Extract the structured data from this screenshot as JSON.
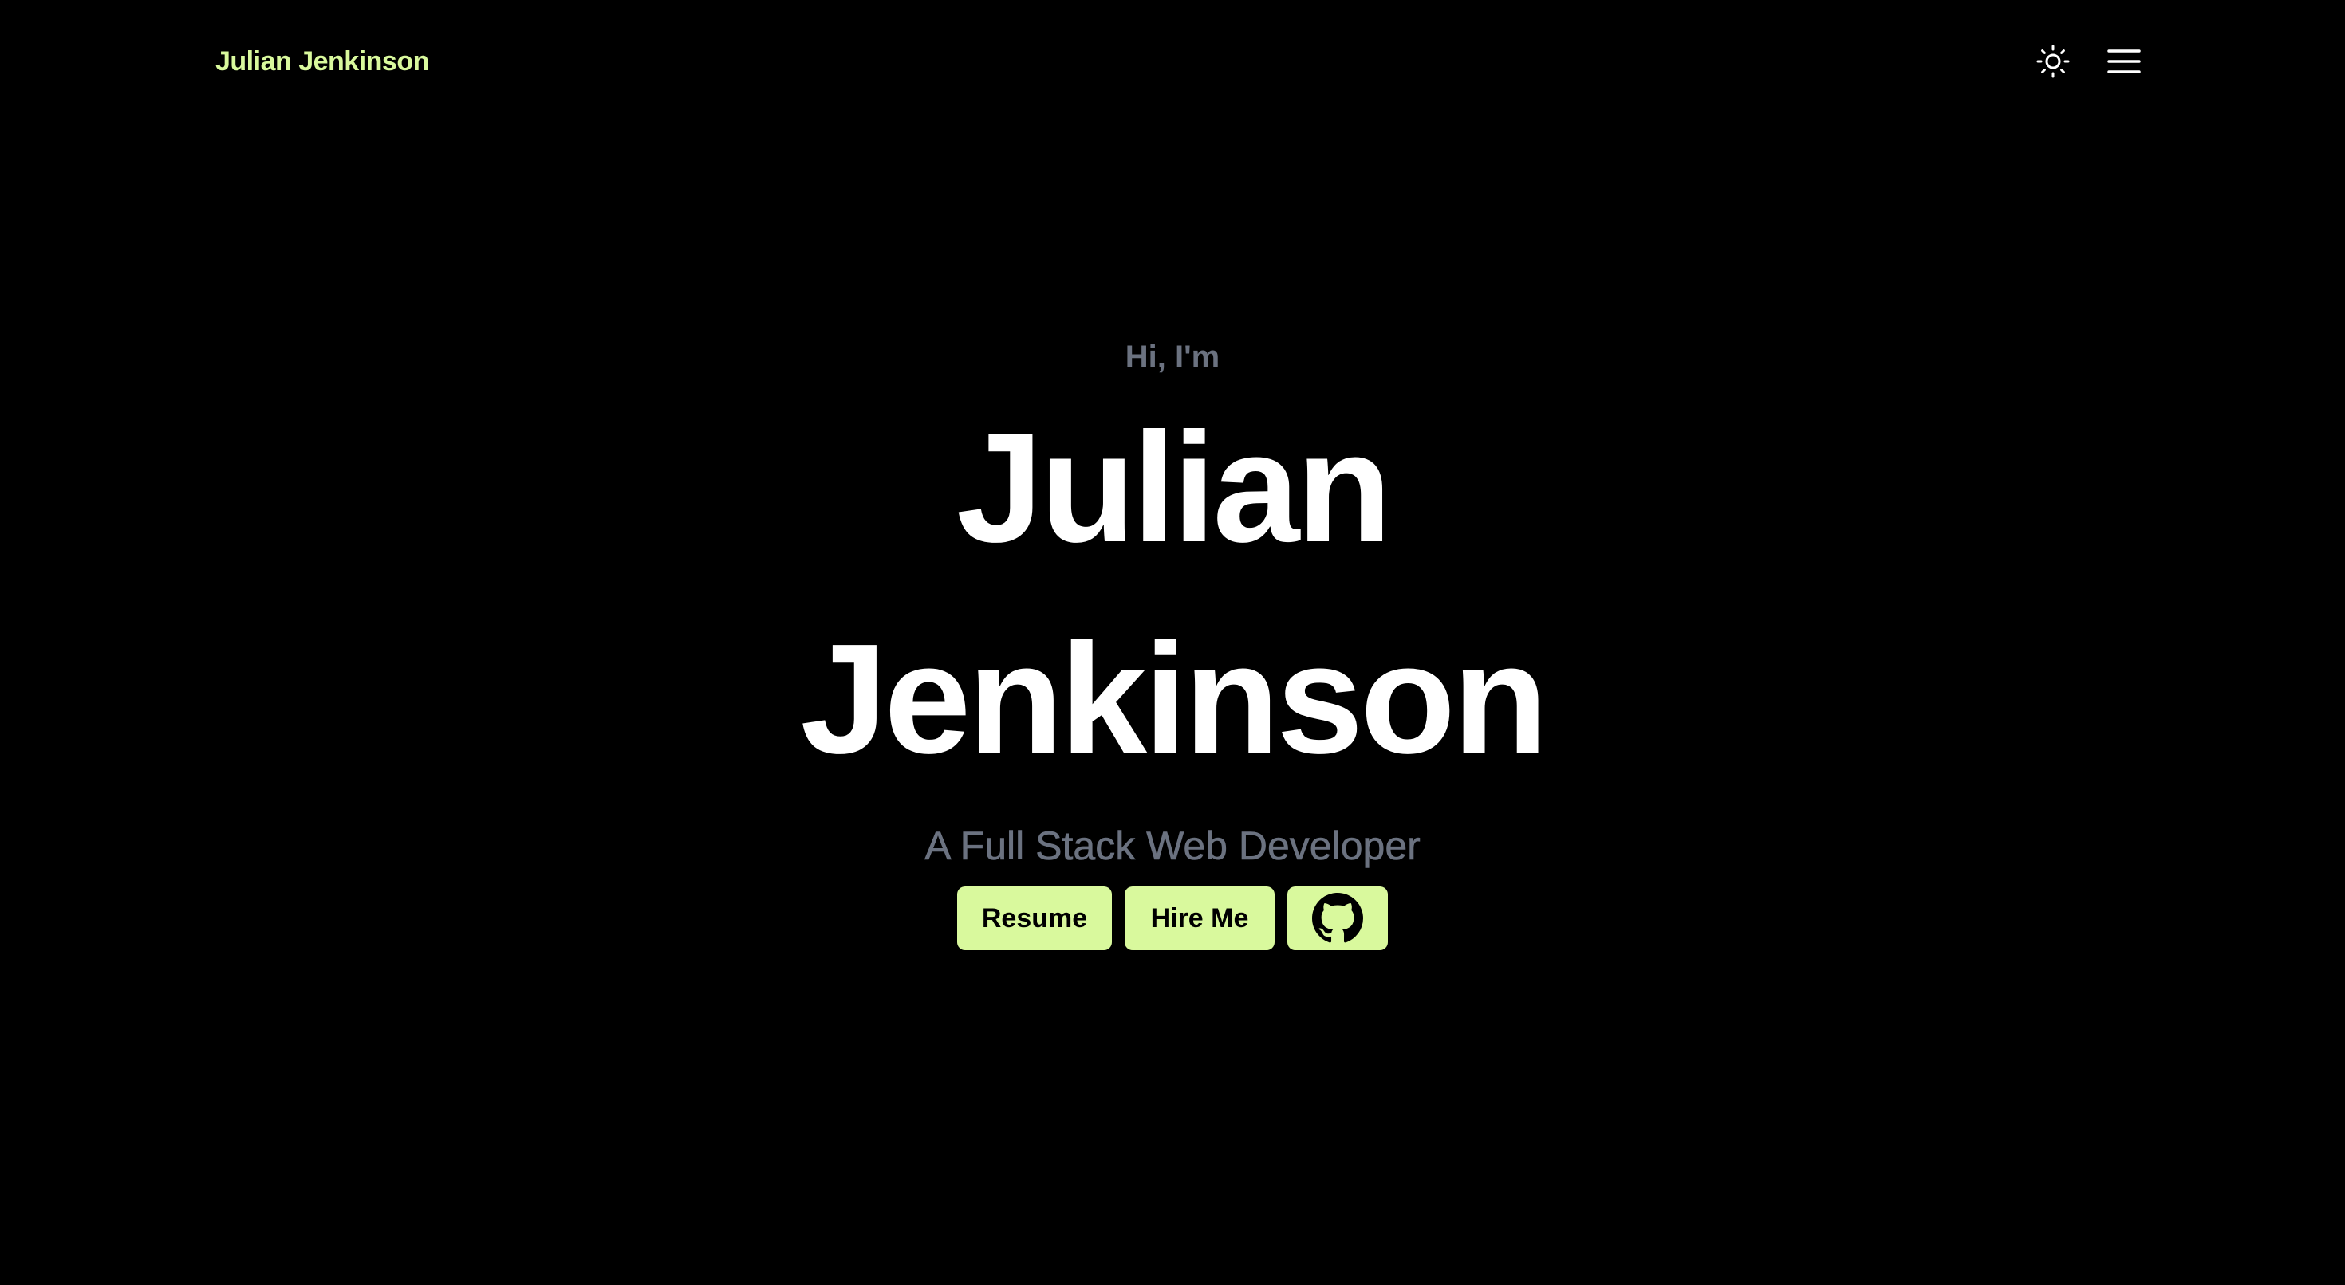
{
  "header": {
    "site_name": "Julian Jenkinson",
    "theme_toggle_icon": "sun-icon",
    "menu_icon": "hamburger-menu-icon"
  },
  "hero": {
    "greeting": "Hi, I'm",
    "first_name": "Julian",
    "last_name": "Jenkinson",
    "tagline": "A Full Stack Web Developer"
  },
  "actions": {
    "resume_label": "Resume",
    "hire_label": "Hire Me",
    "github_icon": "github-icon"
  },
  "colors": {
    "background": "#000000",
    "accent": "#d9f99d",
    "muted_text": "#6b7280",
    "heading_text": "#ffffff"
  }
}
